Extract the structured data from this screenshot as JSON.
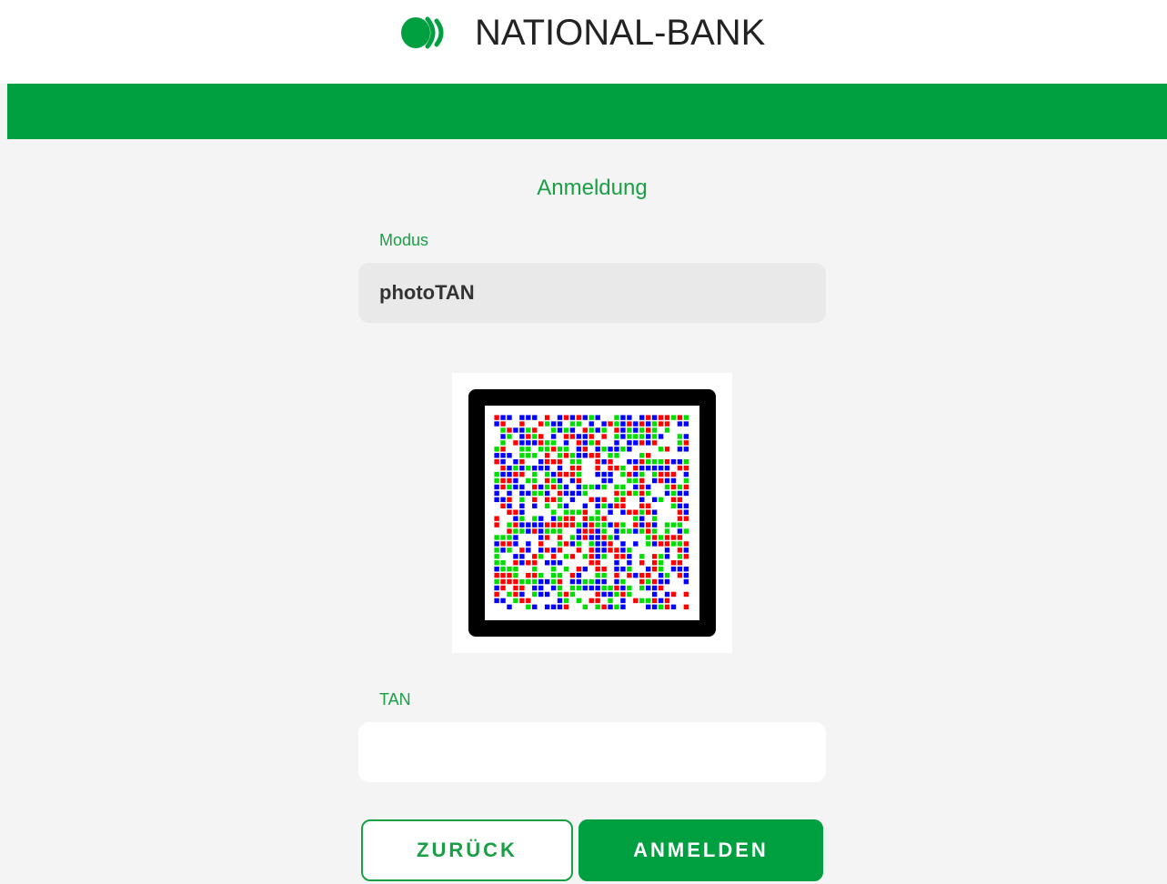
{
  "brand": {
    "name": "NATIONAL-BANK",
    "logo_icon": "national-bank-logo-icon",
    "accent_color": "#00a040"
  },
  "login": {
    "title": "Anmeldung",
    "mode_label": "Modus",
    "mode_value": "photoTAN",
    "tan_label": "TAN",
    "tan_value": "",
    "back_button": "ZURÜCK",
    "login_button": "ANMELDEN"
  },
  "phototan": {
    "colors": [
      "#ff0000",
      "#00dd00",
      "#0000ff"
    ]
  }
}
